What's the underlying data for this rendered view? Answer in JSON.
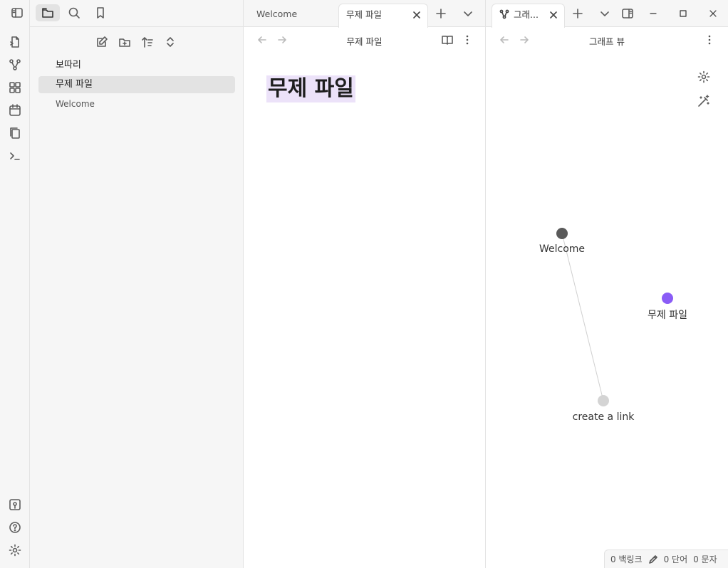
{
  "sidebar": {
    "files": [
      {
        "name": "보따리"
      },
      {
        "name": "무제 파일"
      },
      {
        "name": "Welcome"
      }
    ]
  },
  "left_pane": {
    "tabs": [
      {
        "label": "Welcome"
      },
      {
        "label": "무제 파일"
      }
    ],
    "view_title": "무제 파일",
    "note_heading": "무제 파일"
  },
  "right_pane": {
    "tab_label": "그래...",
    "view_title": "그래프 뷰",
    "graph_nodes": [
      {
        "label": "Welcome"
      },
      {
        "label": "무제 파일"
      },
      {
        "label": "create a link"
      }
    ]
  },
  "status": {
    "backlinks": "0 백링크",
    "words": "0 단어",
    "chars": "0 문자"
  },
  "colors": {
    "accent": "#8a5cf6",
    "highlight": "#ece2f9"
  }
}
